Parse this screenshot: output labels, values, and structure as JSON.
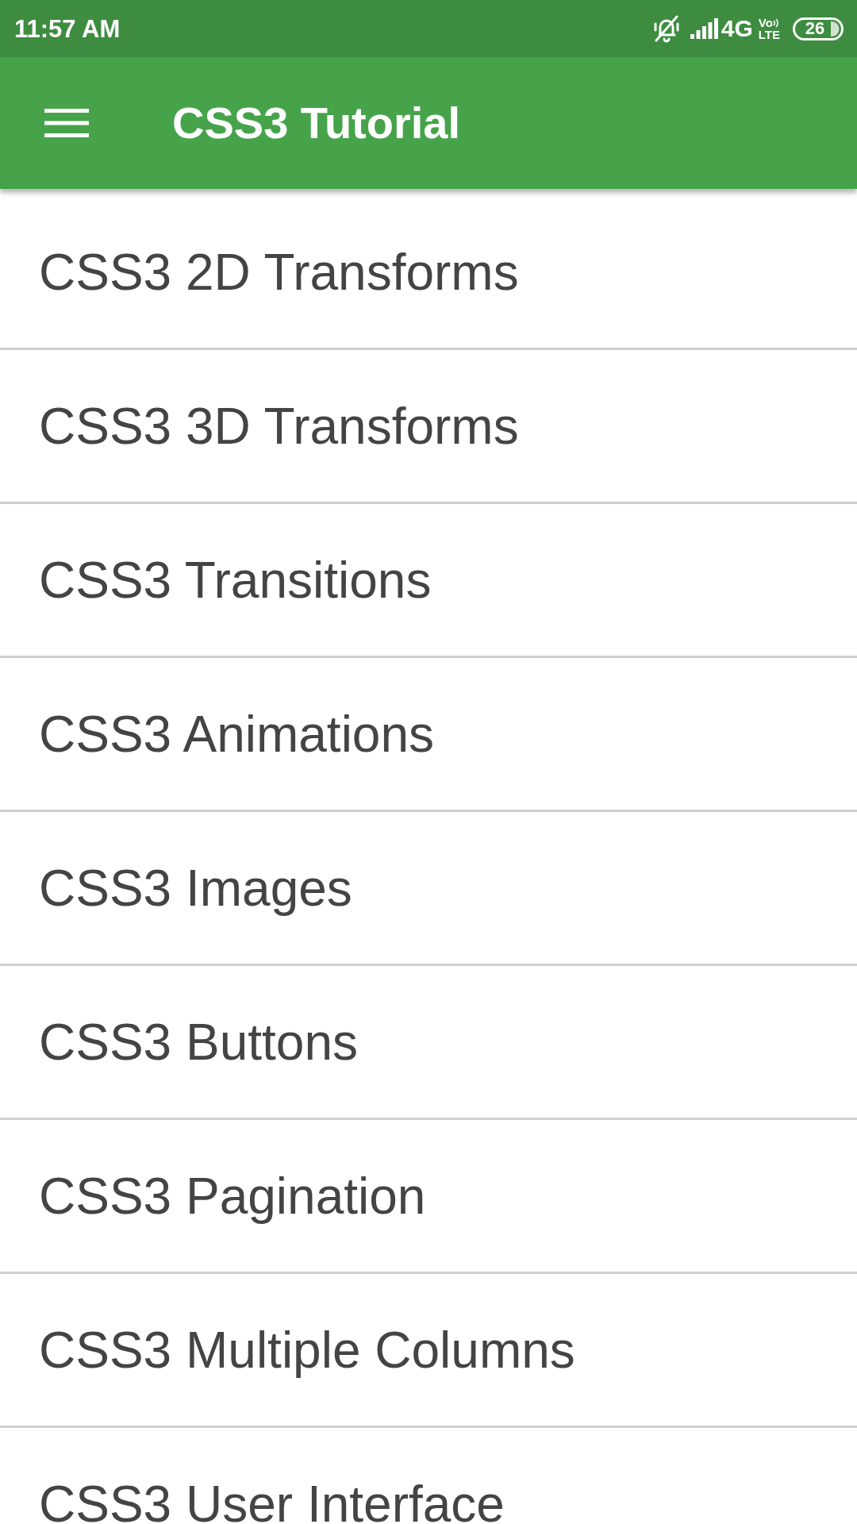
{
  "status_bar": {
    "time": "11:57 AM",
    "network": "4G",
    "volte_top": "Vo",
    "volte_bottom": "LTE",
    "battery": "26"
  },
  "app_bar": {
    "title": "CSS3 Tutorial"
  },
  "list": {
    "items": [
      {
        "label": "CSS3 2D Transforms"
      },
      {
        "label": "CSS3 3D Transforms"
      },
      {
        "label": "CSS3 Transitions"
      },
      {
        "label": "CSS3 Animations"
      },
      {
        "label": "CSS3 Images"
      },
      {
        "label": "CSS3 Buttons"
      },
      {
        "label": "CSS3 Pagination"
      },
      {
        "label": "CSS3 Multiple Columns"
      },
      {
        "label": "CSS3 User Interface"
      }
    ]
  }
}
